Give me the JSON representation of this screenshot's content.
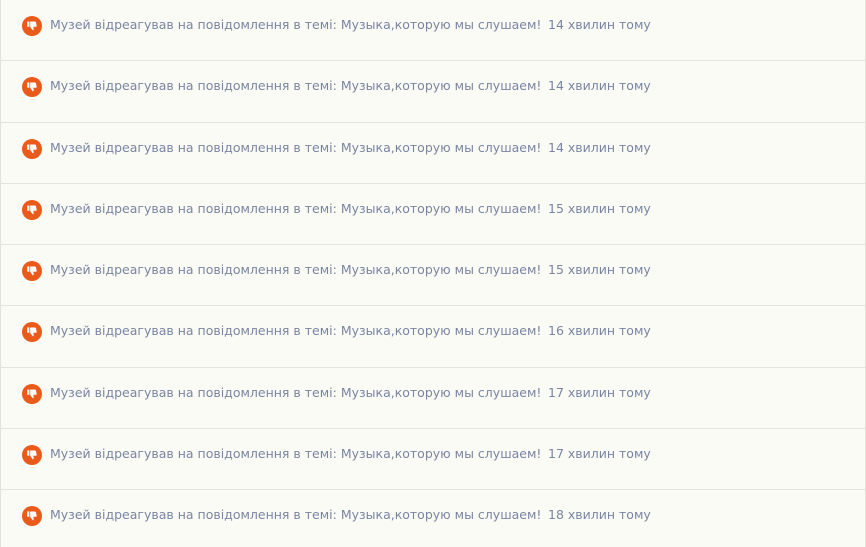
{
  "alerts": [
    {
      "icon": "thumbs-down-icon",
      "text": "Музей відреагував на повідомлення в темі: Музыка,которую мы слушаем!",
      "time": "14 хвилин тому"
    },
    {
      "icon": "thumbs-down-icon",
      "text": "Музей відреагував на повідомлення в темі: Музыка,которую мы слушаем!",
      "time": "14 хвилин тому"
    },
    {
      "icon": "thumbs-down-icon",
      "text": "Музей відреагував на повідомлення в темі: Музыка,которую мы слушаем!",
      "time": "14 хвилин тому"
    },
    {
      "icon": "thumbs-down-icon",
      "text": "Музей відреагував на повідомлення в темі: Музыка,которую мы слушаем!",
      "time": "15 хвилин тому"
    },
    {
      "icon": "thumbs-down-icon",
      "text": "Музей відреагував на повідомлення в темі: Музыка,которую мы слушаем!",
      "time": "15 хвилин тому"
    },
    {
      "icon": "thumbs-down-icon",
      "text": "Музей відреагував на повідомлення в темі: Музыка,которую мы слушаем!",
      "time": "16 хвилин тому"
    },
    {
      "icon": "thumbs-down-icon",
      "text": "Музей відреагував на повідомлення в темі: Музыка,которую мы слушаем!",
      "time": "17 хвилин тому"
    },
    {
      "icon": "thumbs-down-icon",
      "text": "Музей відреагував на повідомлення в темі: Музыка,которую мы слушаем!",
      "time": "17 хвилин тому"
    },
    {
      "icon": "thumbs-down-icon",
      "text": "Музей відреагував на повідомлення в темі: Музыка,которую мы слушаем!",
      "time": "18 хвилин тому"
    }
  ],
  "colors": {
    "icon_bg": "#ea5a1a",
    "text": "#7a85a1",
    "background": "#fbfbf6",
    "divider": "#e4e4dc"
  }
}
